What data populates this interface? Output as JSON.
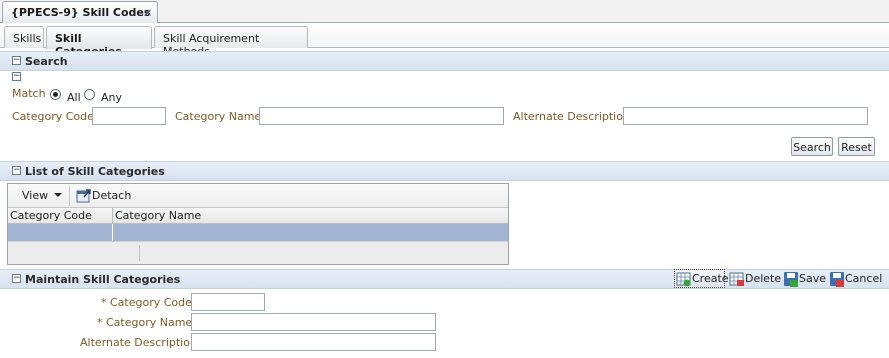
{
  "doc_tab": {
    "title": "{PPECS-9} Skill Codes",
    "close": "×"
  },
  "sub_tabs": [
    {
      "label": "Skills"
    },
    {
      "label": "Skill Categories"
    },
    {
      "label": "Skill Acquirement Methods"
    }
  ],
  "search": {
    "title": "Search",
    "toggle_glyph": "−",
    "match_label": "Match",
    "match_options": [
      "All",
      "Any"
    ],
    "match_selected": "All",
    "fields": {
      "category_code_label": "Category Code",
      "category_name_label": "Category Name",
      "alternate_description_label": "Alternate Description",
      "category_code_value": "",
      "category_name_value": "",
      "alternate_description_value": ""
    },
    "search_button": "Search",
    "reset_button": "Reset"
  },
  "list": {
    "title": "List of Skill Categories",
    "view_label": "View",
    "detach_label": "Detach",
    "columns": [
      "Category Code",
      "Category Name"
    ],
    "rows": [
      {
        "category_code": "",
        "category_name": ""
      }
    ]
  },
  "maintain": {
    "title": "Maintain Skill Categories",
    "actions": {
      "create": "Create",
      "delete": "Delete",
      "save": "Save",
      "cancel": "Cancel"
    },
    "fields": {
      "category_code_label": "* Category Code",
      "category_name_label": "* Category Name",
      "alternate_description_label": "Alternate Description",
      "category_code_value": "",
      "category_name_value": "",
      "alternate_description_value": ""
    }
  },
  "colors": {
    "section_header": "#d7e2ef",
    "label_brown": "#7d5a27",
    "selected_row": "#a3b4d2"
  }
}
